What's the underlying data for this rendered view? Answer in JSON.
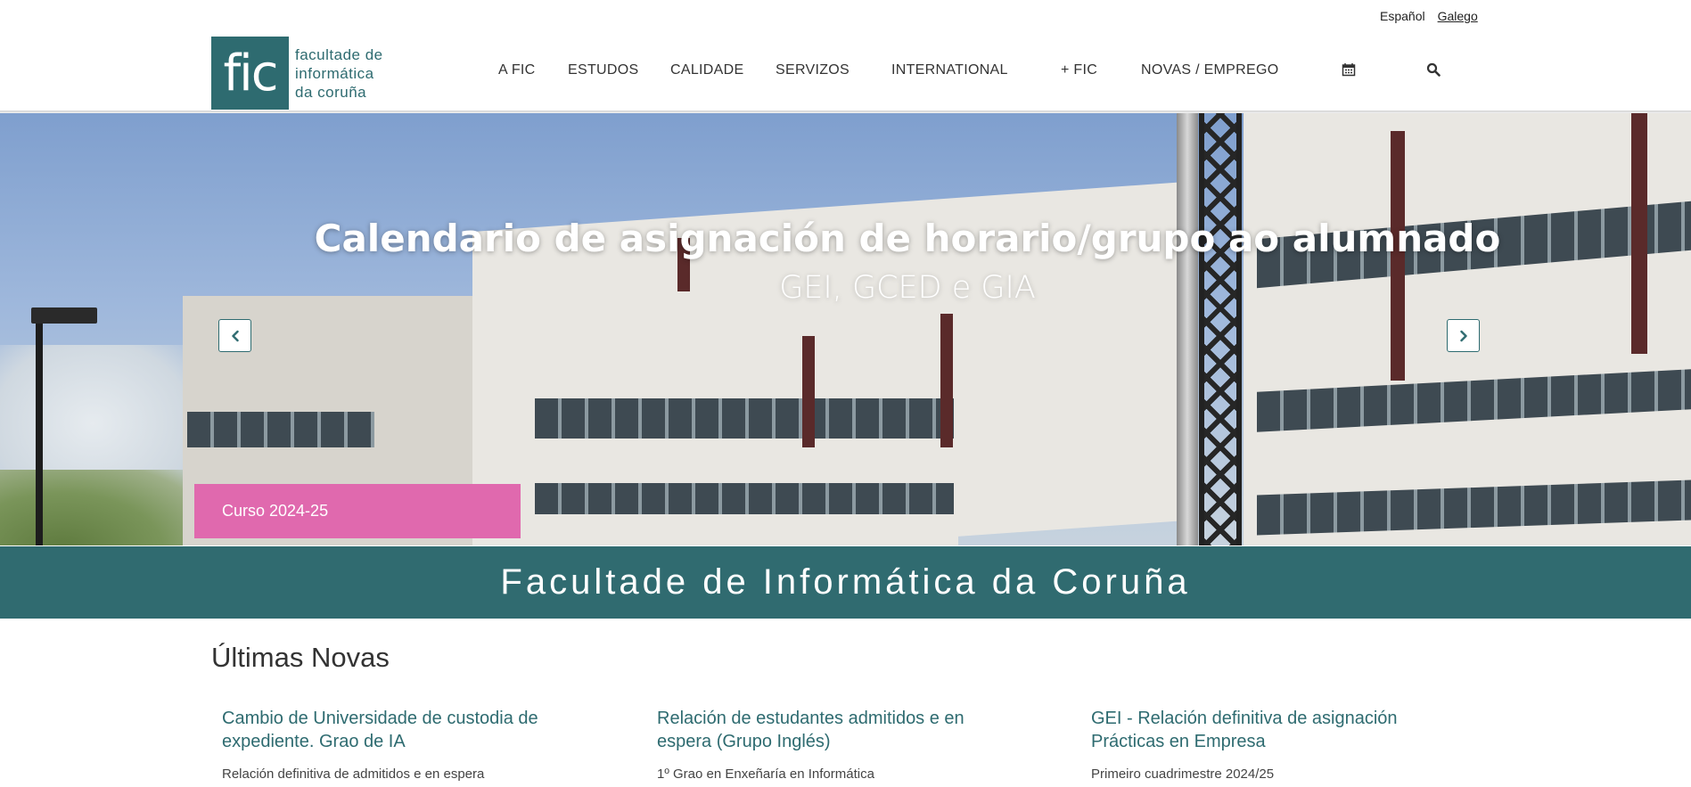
{
  "language_bar": {
    "spanish": "Español",
    "galician": "Galego"
  },
  "logo": {
    "mark": "fic",
    "line1": "facultade de",
    "line2": "informática",
    "line3": "da coruña"
  },
  "nav": {
    "items": [
      "A FIC",
      "ESTUDOS",
      "CALIDADE",
      "SERVIZOS",
      "INTERNATIONAL",
      "+ FIC",
      "NOVAS / EMPREGO"
    ],
    "icons": [
      "calendar-icon",
      "search-icon"
    ]
  },
  "hero": {
    "title": "Calendario de asignación de horario/grupo ao alumnado",
    "subtitle": "GEI, GCED e GIA",
    "badge": "Curso 2024-25"
  },
  "band": {
    "title": "Facultade de Informática da Coruña"
  },
  "news": {
    "heading": "Últimas Novas",
    "items": [
      {
        "title": "Cambio de Universidade de custodia de expediente. Grao de IA",
        "subtitle": "Relación definitiva de admitidos e en espera"
      },
      {
        "title": "Relación de estudantes admitidos e en espera (Grupo Inglés)",
        "subtitle": "1º Grao en Enxeñaría en Informática"
      },
      {
        "title": "GEI - Relación definitiva de asignación Prácticas en Empresa",
        "subtitle": "Primeiro cuadrimestre 2024/25"
      }
    ]
  },
  "colors": {
    "brand": "#306b70",
    "badge": "#e069ae"
  }
}
